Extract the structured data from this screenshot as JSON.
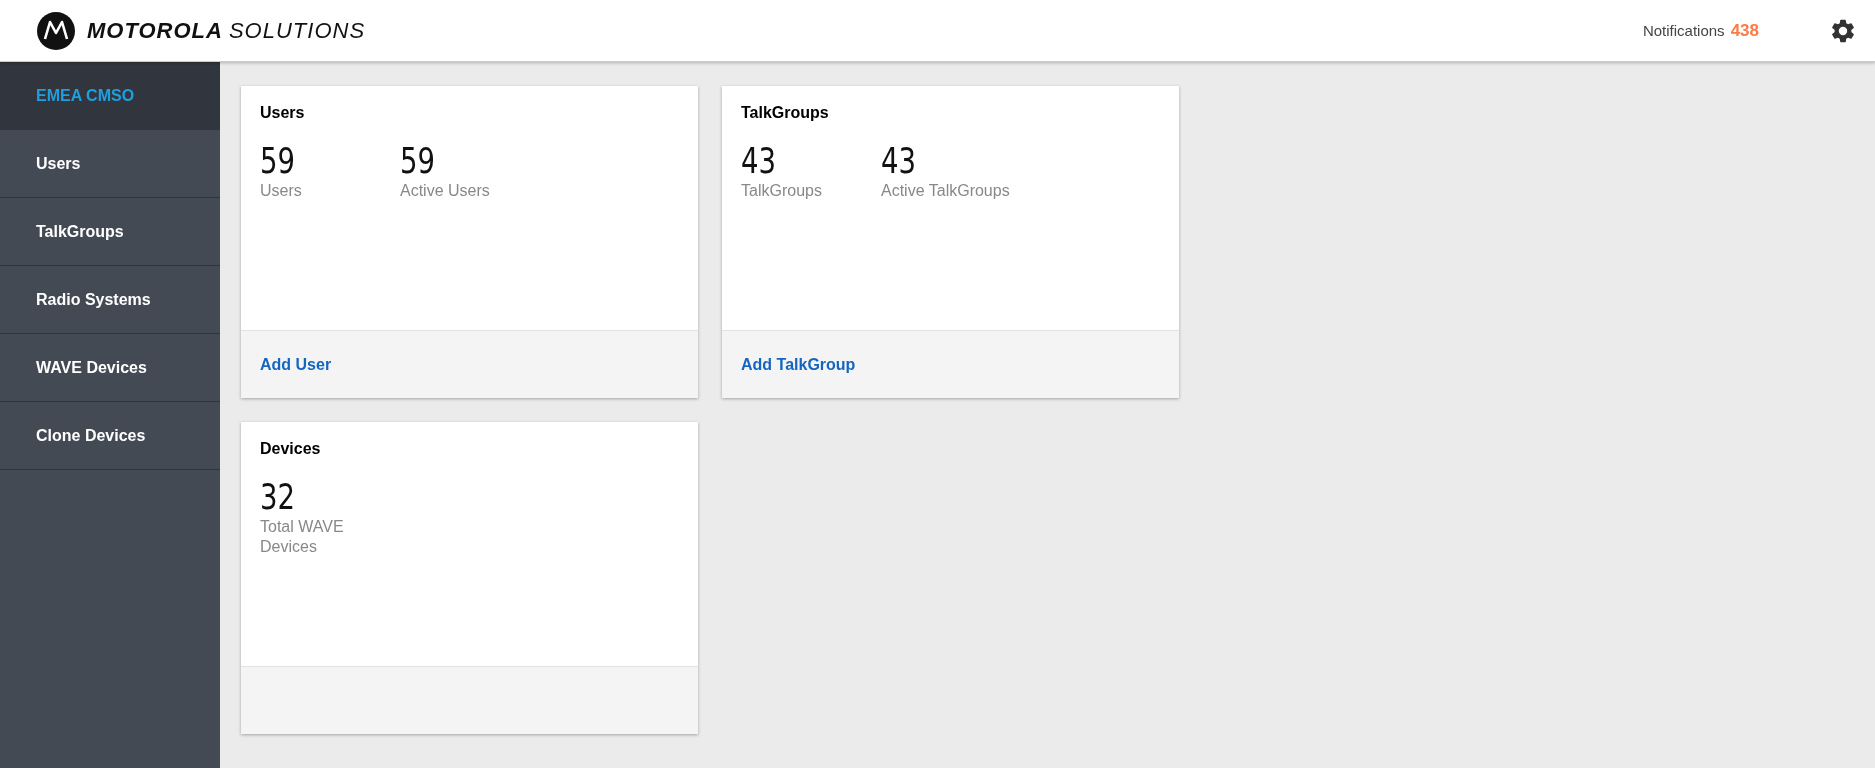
{
  "header": {
    "logo": {
      "brand": "MOTOROLA",
      "suffix": "SOLUTIONS"
    },
    "notifications": {
      "label": "Notifications",
      "count": "438"
    }
  },
  "sidebar": {
    "items": [
      {
        "label": "EMEA CMSO",
        "selected": true
      },
      {
        "label": "Users",
        "selected": false
      },
      {
        "label": "TalkGroups",
        "selected": false
      },
      {
        "label": "Radio Systems",
        "selected": false
      },
      {
        "label": "WAVE Devices",
        "selected": false
      },
      {
        "label": "Clone Devices",
        "selected": false
      }
    ]
  },
  "cards": [
    {
      "title": "Users",
      "stats": [
        {
          "value": "59",
          "label": "Users"
        },
        {
          "value": "59",
          "label": "Active Users"
        }
      ],
      "action": "Add User"
    },
    {
      "title": "TalkGroups",
      "stats": [
        {
          "value": "43",
          "label": "TalkGroups"
        },
        {
          "value": "43",
          "label": "Active TalkGroups"
        }
      ],
      "action": "Add TalkGroup"
    },
    {
      "title": "Devices",
      "stats": [
        {
          "value": "32",
          "label": "Total WAVE Devices"
        }
      ]
    }
  ]
}
